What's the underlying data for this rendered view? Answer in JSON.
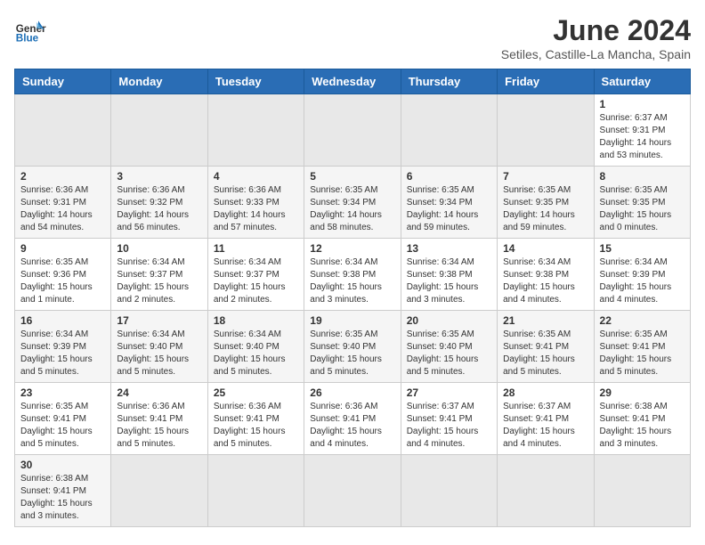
{
  "header": {
    "logo_general": "General",
    "logo_blue": "Blue",
    "month_title": "June 2024",
    "subtitle": "Setiles, Castille-La Mancha, Spain"
  },
  "days_of_week": [
    "Sunday",
    "Monday",
    "Tuesday",
    "Wednesday",
    "Thursday",
    "Friday",
    "Saturday"
  ],
  "weeks": [
    {
      "row_bg": "light",
      "days": [
        {
          "num": "",
          "info": ""
        },
        {
          "num": "",
          "info": ""
        },
        {
          "num": "",
          "info": ""
        },
        {
          "num": "",
          "info": ""
        },
        {
          "num": "",
          "info": ""
        },
        {
          "num": "",
          "info": ""
        },
        {
          "num": "1",
          "info": "Sunrise: 6:37 AM\nSunset: 9:31 PM\nDaylight: 14 hours\nand 53 minutes."
        }
      ]
    },
    {
      "row_bg": "dark",
      "days": [
        {
          "num": "2",
          "info": "Sunrise: 6:36 AM\nSunset: 9:31 PM\nDaylight: 14 hours\nand 54 minutes."
        },
        {
          "num": "3",
          "info": "Sunrise: 6:36 AM\nSunset: 9:32 PM\nDaylight: 14 hours\nand 56 minutes."
        },
        {
          "num": "4",
          "info": "Sunrise: 6:36 AM\nSunset: 9:33 PM\nDaylight: 14 hours\nand 57 minutes."
        },
        {
          "num": "5",
          "info": "Sunrise: 6:35 AM\nSunset: 9:34 PM\nDaylight: 14 hours\nand 58 minutes."
        },
        {
          "num": "6",
          "info": "Sunrise: 6:35 AM\nSunset: 9:34 PM\nDaylight: 14 hours\nand 59 minutes."
        },
        {
          "num": "7",
          "info": "Sunrise: 6:35 AM\nSunset: 9:35 PM\nDaylight: 14 hours\nand 59 minutes."
        },
        {
          "num": "8",
          "info": "Sunrise: 6:35 AM\nSunset: 9:35 PM\nDaylight: 15 hours\nand 0 minutes."
        }
      ]
    },
    {
      "row_bg": "light",
      "days": [
        {
          "num": "9",
          "info": "Sunrise: 6:35 AM\nSunset: 9:36 PM\nDaylight: 15 hours\nand 1 minute."
        },
        {
          "num": "10",
          "info": "Sunrise: 6:34 AM\nSunset: 9:37 PM\nDaylight: 15 hours\nand 2 minutes."
        },
        {
          "num": "11",
          "info": "Sunrise: 6:34 AM\nSunset: 9:37 PM\nDaylight: 15 hours\nand 2 minutes."
        },
        {
          "num": "12",
          "info": "Sunrise: 6:34 AM\nSunset: 9:38 PM\nDaylight: 15 hours\nand 3 minutes."
        },
        {
          "num": "13",
          "info": "Sunrise: 6:34 AM\nSunset: 9:38 PM\nDaylight: 15 hours\nand 3 minutes."
        },
        {
          "num": "14",
          "info": "Sunrise: 6:34 AM\nSunset: 9:38 PM\nDaylight: 15 hours\nand 4 minutes."
        },
        {
          "num": "15",
          "info": "Sunrise: 6:34 AM\nSunset: 9:39 PM\nDaylight: 15 hours\nand 4 minutes."
        }
      ]
    },
    {
      "row_bg": "dark",
      "days": [
        {
          "num": "16",
          "info": "Sunrise: 6:34 AM\nSunset: 9:39 PM\nDaylight: 15 hours\nand 5 minutes."
        },
        {
          "num": "17",
          "info": "Sunrise: 6:34 AM\nSunset: 9:40 PM\nDaylight: 15 hours\nand 5 minutes."
        },
        {
          "num": "18",
          "info": "Sunrise: 6:34 AM\nSunset: 9:40 PM\nDaylight: 15 hours\nand 5 minutes."
        },
        {
          "num": "19",
          "info": "Sunrise: 6:35 AM\nSunset: 9:40 PM\nDaylight: 15 hours\nand 5 minutes."
        },
        {
          "num": "20",
          "info": "Sunrise: 6:35 AM\nSunset: 9:40 PM\nDaylight: 15 hours\nand 5 minutes."
        },
        {
          "num": "21",
          "info": "Sunrise: 6:35 AM\nSunset: 9:41 PM\nDaylight: 15 hours\nand 5 minutes."
        },
        {
          "num": "22",
          "info": "Sunrise: 6:35 AM\nSunset: 9:41 PM\nDaylight: 15 hours\nand 5 minutes."
        }
      ]
    },
    {
      "row_bg": "light",
      "days": [
        {
          "num": "23",
          "info": "Sunrise: 6:35 AM\nSunset: 9:41 PM\nDaylight: 15 hours\nand 5 minutes."
        },
        {
          "num": "24",
          "info": "Sunrise: 6:36 AM\nSunset: 9:41 PM\nDaylight: 15 hours\nand 5 minutes."
        },
        {
          "num": "25",
          "info": "Sunrise: 6:36 AM\nSunset: 9:41 PM\nDaylight: 15 hours\nand 5 minutes."
        },
        {
          "num": "26",
          "info": "Sunrise: 6:36 AM\nSunset: 9:41 PM\nDaylight: 15 hours\nand 4 minutes."
        },
        {
          "num": "27",
          "info": "Sunrise: 6:37 AM\nSunset: 9:41 PM\nDaylight: 15 hours\nand 4 minutes."
        },
        {
          "num": "28",
          "info": "Sunrise: 6:37 AM\nSunset: 9:41 PM\nDaylight: 15 hours\nand 4 minutes."
        },
        {
          "num": "29",
          "info": "Sunrise: 6:38 AM\nSunset: 9:41 PM\nDaylight: 15 hours\nand 3 minutes."
        }
      ]
    },
    {
      "row_bg": "dark",
      "days": [
        {
          "num": "30",
          "info": "Sunrise: 6:38 AM\nSunset: 9:41 PM\nDaylight: 15 hours\nand 3 minutes."
        },
        {
          "num": "",
          "info": ""
        },
        {
          "num": "",
          "info": ""
        },
        {
          "num": "",
          "info": ""
        },
        {
          "num": "",
          "info": ""
        },
        {
          "num": "",
          "info": ""
        },
        {
          "num": "",
          "info": ""
        }
      ]
    }
  ]
}
